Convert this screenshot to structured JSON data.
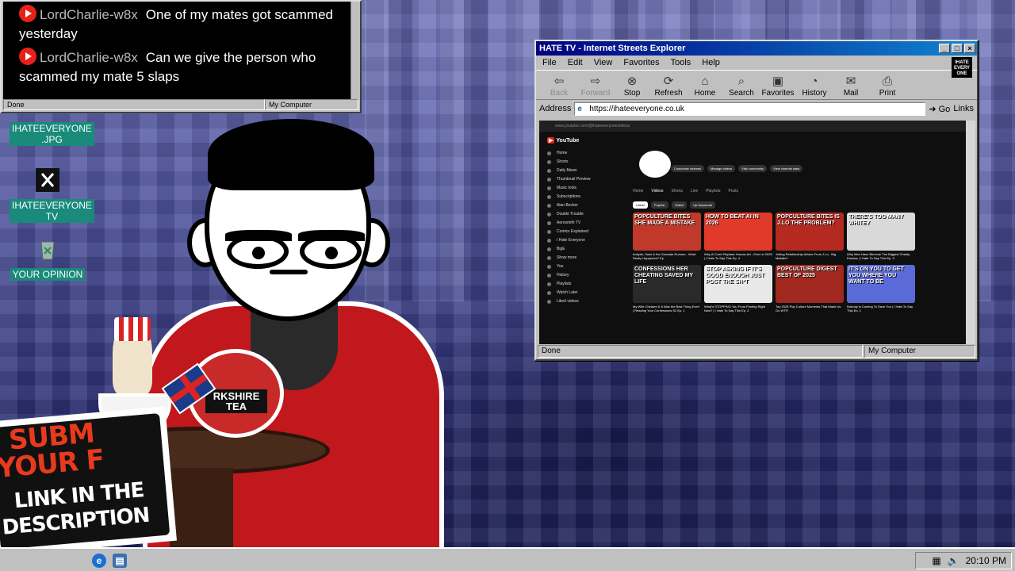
{
  "chat": {
    "messages": [
      {
        "user": "LordCharlie-w8x",
        "text": "One of my mates got scammed yesterday"
      },
      {
        "user": "LordCharlie-w8x",
        "text": "Can we give the person who scammed my mate 5 slaps"
      }
    ],
    "status_left": "Done",
    "status_right": "My Computer"
  },
  "desktop_icons": [
    {
      "label": "IHATEEVERYONE .JPG",
      "icon": "image-file-icon"
    },
    {
      "label": "IHATEEVERYONE TV",
      "icon": "x-logo-icon"
    },
    {
      "label": "YOUR OPINION",
      "icon": "recycle-bin-icon"
    }
  ],
  "browser": {
    "title": "HATE TV - Internet Streets Explorer",
    "menu": [
      "File",
      "Edit",
      "View",
      "Favorites",
      "Tools",
      "Help"
    ],
    "toolbar": [
      {
        "label": "Back",
        "icon": "back-arrow-icon",
        "disabled": true
      },
      {
        "label": "Forward",
        "icon": "forward-arrow-icon",
        "disabled": true
      },
      {
        "label": "Stop",
        "icon": "stop-icon"
      },
      {
        "label": "Refresh",
        "icon": "refresh-icon"
      },
      {
        "label": "Home",
        "icon": "home-icon"
      },
      {
        "label": "Search",
        "icon": "search-icon"
      },
      {
        "label": "Favorites",
        "icon": "favorites-icon"
      },
      {
        "label": "History",
        "icon": "history-icon"
      },
      {
        "label": "Mail",
        "icon": "mail-icon"
      },
      {
        "label": "Print",
        "icon": "print-icon"
      }
    ],
    "address_label": "Address",
    "url": "https://ihateeveryone.co.uk",
    "go_label": "Go",
    "links_label": "Links",
    "status_left": "Done",
    "status_right": "My Computer",
    "logo_text": "IHATE EVERY ONE",
    "youtube": {
      "logo": "YouTube",
      "sidebar": [
        "Home",
        "Shorts",
        "Daily Mews",
        "Thumbnail Preview",
        "Music tools",
        "Subscriptions",
        "Alan Becker",
        "Double Trouble",
        "Aerosmith TV",
        "Comics Explained",
        "I Hate Everyone",
        "BigE",
        "Show more",
        "You",
        "History",
        "Playlists",
        "Watch Later",
        "Liked videos"
      ],
      "channel_buttons": [
        "Customise channel",
        "Manage videos",
        "Visit community",
        "View channel stats"
      ],
      "tabs": [
        "Home",
        "Videos",
        "Shorts",
        "Live",
        "Playlists",
        "Posts"
      ],
      "chips": [
        "Latest",
        "Popular",
        "Oldest",
        "Up Keywords"
      ],
      "videos": [
        {
          "thumb": "POPCULTURE BITES SHE MADE A MISTAKE",
          "color": "#c0392b",
          "title": "Indiyah, Sami & the Gravatar Rumors - What Really Happened? Ep"
        },
        {
          "thumb": "HOW TO BEAT AI IN 2026",
          "color": "#e03a2a",
          "title": "Why AI Can't Replace Human Art - Even in 2026 | I Hate To Say This Ep. 4"
        },
        {
          "thumb": "POPCULTURE BITES IS J.LO THE PROBLEM?",
          "color": "#b52a20",
          "title": "Jolting Relationship Advice From J.Lo - Big Mistake?"
        },
        {
          "thumb": "THERE'S TOO MANY WHITEY",
          "color": "#d9d9d9",
          "title": "Why Men Have Become The Biggest Charity Pandas | I Hate To Say This Ep. 3"
        },
        {
          "thumb": "CONFESSIONS HER CHEATING SAVED MY LIFE",
          "color": "#2a2a2a",
          "title": "My Wife Cheated & It Was the Best Thing Ever! | Reading Your Confessions S2 Ep. 1"
        },
        {
          "thumb": "STOP ASKING IF IT'S GOOD ENOUGH JUST POST THE SH*T",
          "color": "#e8e8e8",
          "title": "What's STOPPING You From Posting Right Now? | I Hate To Say This Ep. 2"
        },
        {
          "thumb": "POPCULTURE DIGEST BEST OF 2025",
          "color": "#a0281e",
          "title": "Top 2025 Pop Culture Moments That Made Us Go WTF!"
        },
        {
          "thumb": "IT'S ON YOU TO GET YOU WHERE YOU WANT TO BE",
          "color": "#5a6ad8",
          "title": "Nobody is Coming To Save You | I Hate To Say This Ep. 1"
        }
      ]
    }
  },
  "sign": {
    "line1": "SUBM",
    "line2": "YOUR F",
    "line3": "LINK IN THE",
    "line4": "DESCRIPTION"
  },
  "teapot_label": "RKSHIRE TEA",
  "taskbar": {
    "clock": "20:10 PM"
  }
}
